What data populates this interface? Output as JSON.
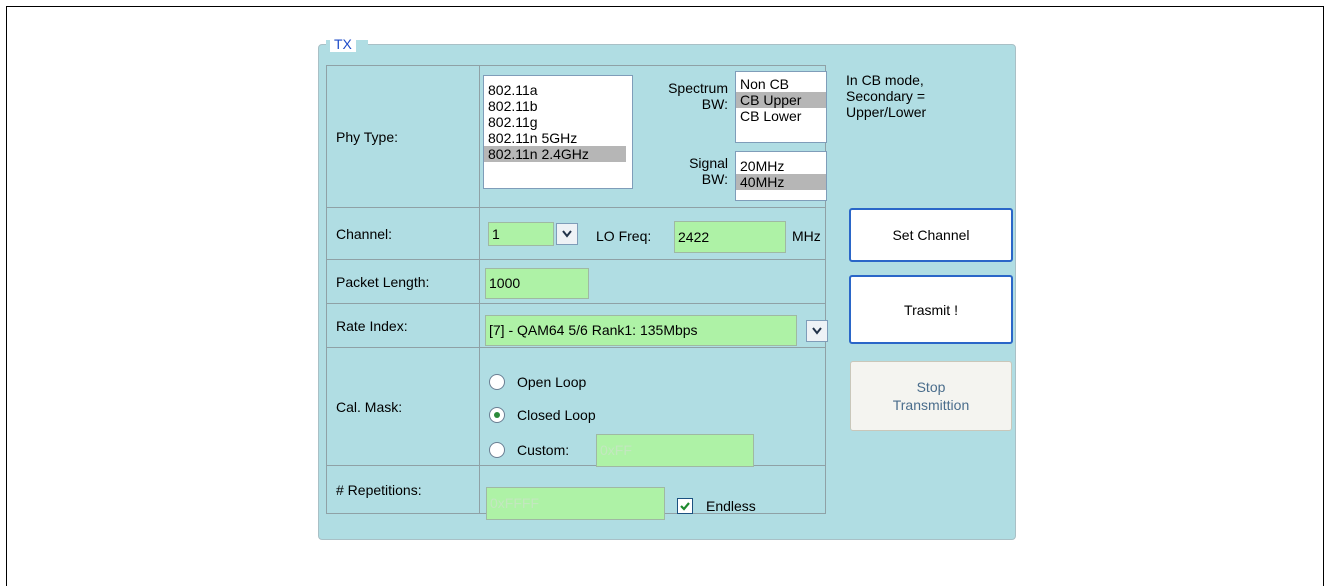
{
  "group": {
    "title": "TX"
  },
  "labels": {
    "phy_type": "Phy Type:",
    "channel": "Channel:",
    "packet_length": "Packet Length:",
    "rate_index": "Rate Index:",
    "cal_mask": "Cal. Mask:",
    "repetitions": "# Repetitions:"
  },
  "phy_list": {
    "items": [
      "802.11a",
      "802.11b",
      "802.11g",
      "802.11n 5GHz",
      "802.11n 2.4GHz"
    ],
    "selected": "802.11n 2.4GHz"
  },
  "spectrum_bw": {
    "label_line1": "Spectrum",
    "label_line2": "BW:",
    "items": [
      "Non CB",
      "CB Upper",
      "CB Lower"
    ],
    "selected": "CB Upper"
  },
  "signal_bw": {
    "label_line1": "Signal",
    "label_line2": "BW:",
    "items": [
      "20MHz",
      "40MHz"
    ],
    "selected": "40MHz"
  },
  "channel": {
    "value": "1",
    "lo_freq_label": "LO Freq:",
    "lo_freq_value": "2422",
    "unit": "MHz"
  },
  "packet_length": {
    "value": "1000"
  },
  "rate_index": {
    "value": "[7] - QAM64 5/6 Rank1: 135Mbps"
  },
  "cal_mask": {
    "options": [
      "Open Loop",
      "Closed Loop",
      "Custom:"
    ],
    "selected": "Closed Loop",
    "custom_value": "0xFF"
  },
  "repetitions": {
    "value": "0xFFFF",
    "endless_label": "Endless",
    "endless_checked": true
  },
  "note": {
    "line1": "In CB mode,",
    "line2": "Secondary =",
    "line3": "Upper/Lower"
  },
  "buttons": {
    "set_channel": "Set Channel",
    "transmit": "Trasmit !",
    "stop_line1": "Stop",
    "stop_line2": "Transmittion"
  },
  "colors": {
    "panel_bg": "#b0dde3",
    "input_green": "#aef2a6",
    "title_blue": "#1f4cc9",
    "selection_gray": "#b6b6b6"
  }
}
